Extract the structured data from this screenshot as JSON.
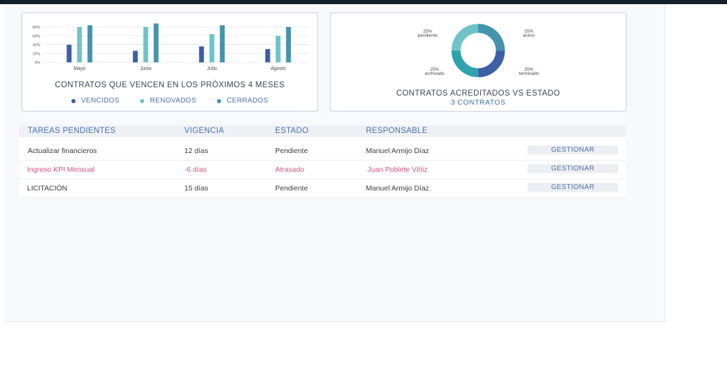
{
  "colors": {
    "dark_blue": "#3d5fa5",
    "light_teal": "#70c3c8",
    "teal": "#4593ad",
    "late_red": "#d1537a"
  },
  "bar_card": {
    "title": "CONTRATOS QUE VENCEN EN LOS PRÓXIMOS 4 MESES",
    "legend": [
      {
        "label": "VENCIDOS",
        "color": "#3d5fa5"
      },
      {
        "label": "RENOVADOS",
        "color": "#70c3c8"
      },
      {
        "label": "CERRADOS",
        "color": "#4593ad"
      }
    ]
  },
  "donut_card": {
    "title": "CONTRATOS ACREDITADOS VS ESTADO",
    "subtitle": "3 CONTRATOS"
  },
  "chart_data": [
    {
      "type": "bar",
      "title": "CONTRATOS QUE VENCEN EN LOS PRÓXIMOS 4 MESES",
      "categories": [
        "Mayo",
        "Junio",
        "Julio",
        "Agosto"
      ],
      "y_ticks": [
        "0%",
        "20%",
        "40%",
        "60%",
        "80%"
      ],
      "ylim": [
        0,
        90
      ],
      "grid": true,
      "legend_position": "bottom",
      "series": [
        {
          "name": "VENCIDOS",
          "color": "#3d5fa5",
          "values": [
            40,
            26,
            36,
            30
          ]
        },
        {
          "name": "RENOVADOS",
          "color": "#70c3c8",
          "values": [
            80,
            80,
            64,
            60
          ]
        },
        {
          "name": "CERRADOS",
          "color": "#4593ad",
          "values": [
            84,
            88,
            84,
            80
          ]
        }
      ]
    },
    {
      "type": "pie",
      "title": "CONTRATOS ACREDITADOS VS ESTADO",
      "subtitle": "3 CONTRATOS",
      "slices": [
        {
          "label": "activo",
          "value": 25,
          "pct_label": "25%",
          "color": "#4593ad"
        },
        {
          "label": "terminado",
          "value": 25,
          "pct_label": "25%",
          "color": "#3d5fa5"
        },
        {
          "label": "archivado",
          "value": 25,
          "pct_label": "25%",
          "color": "#2fa3ad"
        },
        {
          "label": "pendiente",
          "value": 25,
          "pct_label": "25%",
          "color": "#70c3c8"
        }
      ]
    }
  ],
  "tasks": {
    "headers": {
      "task": "TAREAS PENDIENTES",
      "vigencia": "VIGENCIA",
      "estado": "ESTADO",
      "responsable": "RESPONSABLE"
    },
    "rows": [
      {
        "task": "Actualizar financieros",
        "vigencia": "12 días",
        "estado": "Pendiente",
        "responsable": "Manuel Armijo Díaz",
        "action": "GESTIONAR",
        "late": false
      },
      {
        "task": "Ingreso KPI Mensual",
        "vigencia": "-6 días",
        "estado": "Atrasado",
        "responsable": "Juan Poblete Véliz",
        "action": "GESTIONAR",
        "late": true
      },
      {
        "task": "LICITACIÓN",
        "vigencia": "15 días",
        "estado": "Pendiente",
        "responsable": "Manuel Armijo Díaz",
        "action": "GESTIONAR",
        "late": false
      }
    ]
  }
}
